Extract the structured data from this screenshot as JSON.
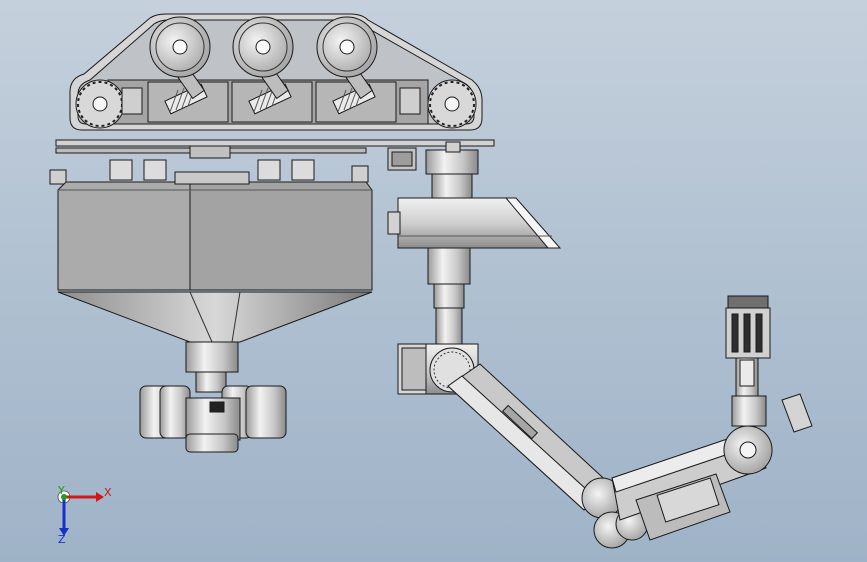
{
  "viewport": {
    "background_top": "#c5d0dc",
    "background_bottom": "#9fb3c8"
  },
  "triad": {
    "x_label": "X",
    "y_label": "Y",
    "z_label": "Z",
    "x_color": "#d01818",
    "y_color": "#18a018",
    "z_color": "#1830c8"
  },
  "colors": {
    "part_light": "#e4e4e4",
    "part_mid": "#bdbdbd",
    "part_dark": "#8e8e8e",
    "edge": "#1a1a1a"
  }
}
